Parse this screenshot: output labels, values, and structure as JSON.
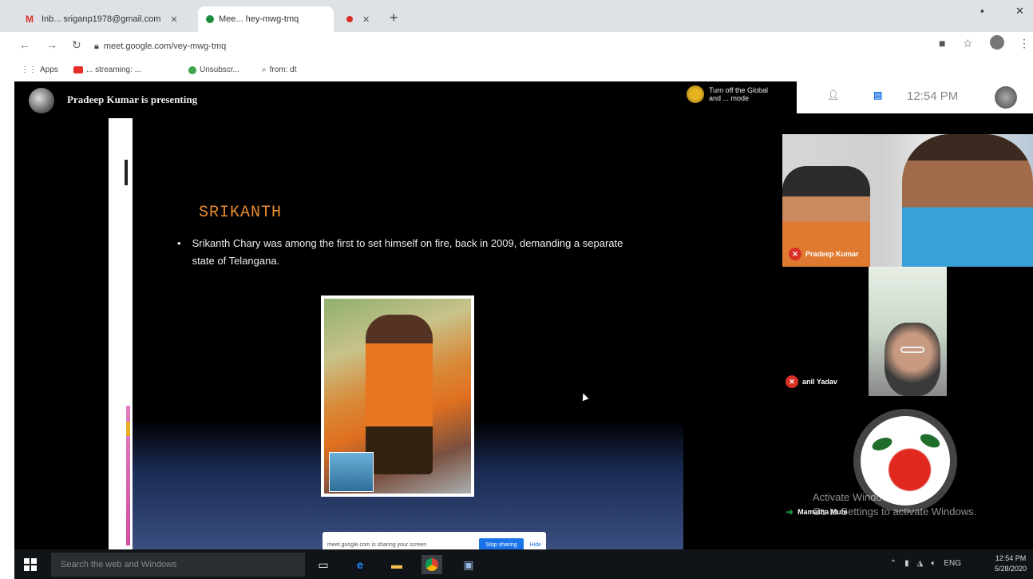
{
  "browser": {
    "tabs": [
      {
        "label": "Inb... sriganp1978@gmail.com",
        "icon": "gmail-icon",
        "active": false
      },
      {
        "label": "Mee... hey-mwg-tmq",
        "icon": "meet-icon",
        "active": true
      },
      {
        "label": "",
        "icon": "record-icon",
        "active": false
      }
    ],
    "url": "meet.google.com/vey-mwg-tmq",
    "bookmarks": [
      {
        "label": "Apps",
        "icon": "apps-icon"
      },
      {
        "label": "... streaming: ...",
        "icon": "youtube-icon"
      },
      {
        "label": "Unsubscr...",
        "icon": "chrome-ext-icon"
      },
      {
        "label": "from: dt",
        "icon": "search-icon"
      }
    ]
  },
  "meet": {
    "presenter_label": "Pradeep Kumar is presenting",
    "stop_label": "Turn off the Global and ... mode",
    "top_right": {
      "participants_count": "",
      "clock": "12:54 PM"
    },
    "participants": [
      {
        "name": "Pradeep Kumar",
        "muted": true
      },
      {
        "name": "anil Yadav",
        "muted": true
      },
      {
        "name": "Mamatha Mute",
        "muted": false
      }
    ]
  },
  "slide": {
    "title": "SRIKANTH",
    "bullet": "Srikanth Chary was among the first to set himself on fire, back in 2009, demanding a separate state of Telangana.",
    "photo_caption": "",
    "share_banner": {
      "text": "meet.google.com is sharing your screen",
      "stop_button": "Stop sharing",
      "hide_button": "Hide"
    }
  },
  "watermark": {
    "line1": "Activate Windows",
    "line2": "Go to Settings to activate Windows."
  },
  "taskbar": {
    "search_placeholder": "Search the web and Windows",
    "apps": [
      "task-view-icon",
      "edge-icon",
      "file-explorer-icon",
      "chrome-icon",
      "notepad-icon"
    ],
    "time": "12:54 PM",
    "date": "5/28/2020",
    "lang": "ENG"
  },
  "colors": {
    "slide_title": "#e88b2f",
    "mic_off": "#d93025",
    "share_button": "#1a73e8"
  }
}
